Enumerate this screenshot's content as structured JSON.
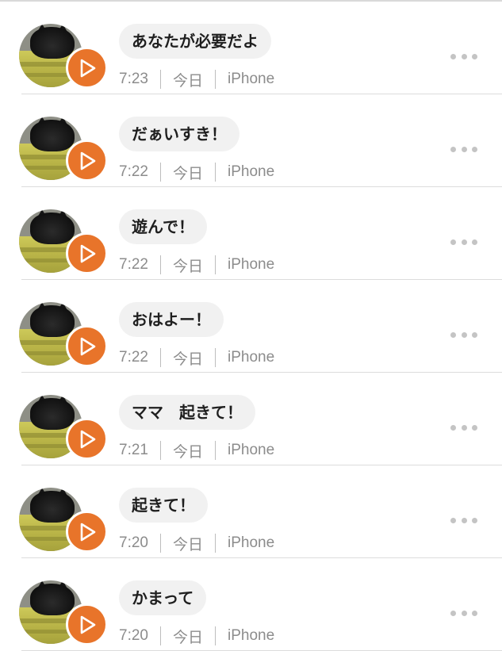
{
  "messages": [
    {
      "text": "あなたが必要だよ",
      "time": "7:23",
      "day": "今日",
      "device": "iPhone"
    },
    {
      "text": "だぁいすき！",
      "time": "7:22",
      "day": "今日",
      "device": "iPhone"
    },
    {
      "text": "遊んで！",
      "time": "7:22",
      "day": "今日",
      "device": "iPhone"
    },
    {
      "text": "おはよー！",
      "time": "7:22",
      "day": "今日",
      "device": "iPhone"
    },
    {
      "text": "ママ　起きて！",
      "time": "7:21",
      "day": "今日",
      "device": "iPhone"
    },
    {
      "text": "起きて！",
      "time": "7:20",
      "day": "今日",
      "device": "iPhone"
    },
    {
      "text": "かまって",
      "time": "7:20",
      "day": "今日",
      "device": "iPhone"
    }
  ],
  "icons": {
    "play": "play-icon",
    "more": "more-horizontal-icon"
  },
  "colors": {
    "play_button": "#e8742a",
    "bubble_bg": "#f1f1f1",
    "meta_text": "#8c8c8c",
    "divider": "#dcdcdc"
  }
}
